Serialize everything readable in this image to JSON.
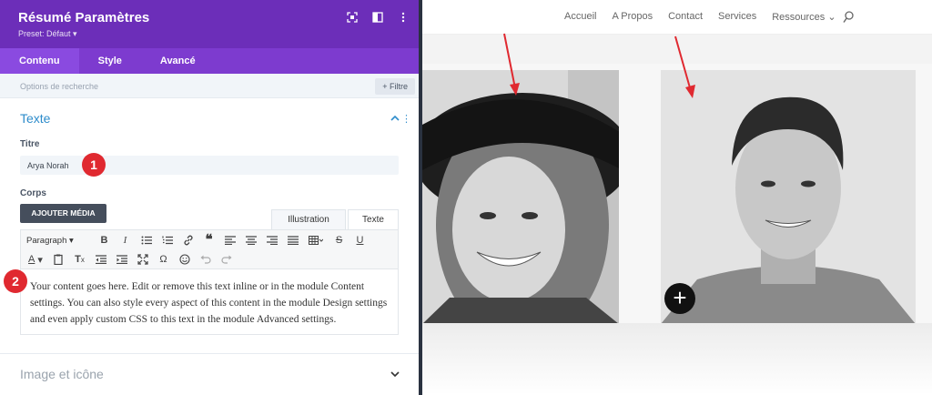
{
  "panel": {
    "title": "Résumé Paramètres",
    "preset": "Preset: Défaut ▾",
    "tabs": [
      {
        "label": "Contenu",
        "active": true
      },
      {
        "label": "Style",
        "active": false
      },
      {
        "label": "Avancé",
        "active": false
      }
    ],
    "search_placeholder": "Options de recherche",
    "filter_label": "+ Filtre",
    "text_section": {
      "title": "Texte",
      "title_label": "Titre",
      "title_value": "Arya Norah",
      "body_label": "Corps",
      "add_media_label": "AJOUTER MÉDIA",
      "editor_tabs": [
        "Illustration",
        "Texte"
      ],
      "format_select": "Paragraph",
      "body_text": "Your content goes here. Edit or remove this text inline or in the module Content settings. You can also style every aspect of this content in the module Design settings and even apply custom CSS to this text in the module Advanced settings."
    },
    "image_section": {
      "title": "Image et icône"
    },
    "annotations": [
      "1",
      "2"
    ]
  },
  "site": {
    "nav": [
      "Accueil",
      "A Propos",
      "Contact",
      "Services",
      "Ressources ⌄"
    ],
    "add_button": "+"
  },
  "colors": {
    "header_purple": "#6c2eb9",
    "tab_purple": "#7d3bcf",
    "section_blue": "#2e8ccb",
    "annotation_red": "#e02930"
  }
}
